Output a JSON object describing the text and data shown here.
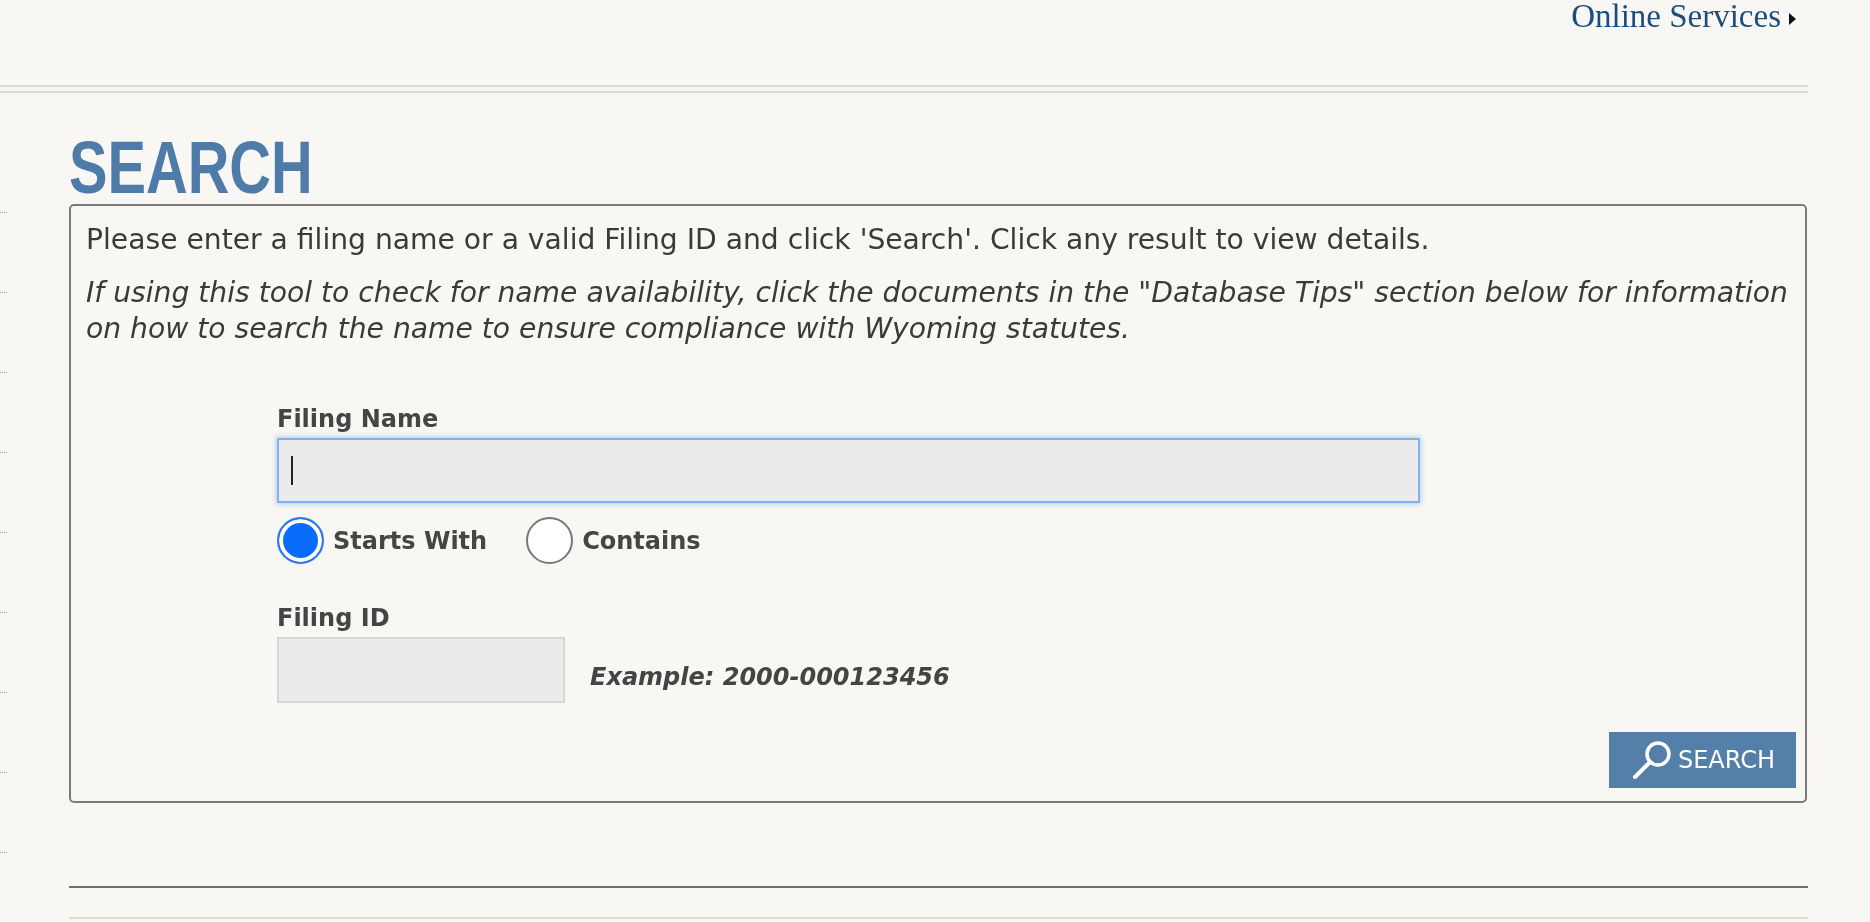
{
  "header": {
    "link": "Online Services"
  },
  "page_title": "SEARCH",
  "search_panel": {
    "intro": "Please enter a filing name or a valid Filing ID and click 'Search'. Click any result to view details.",
    "note": "If using this tool to check for name availability, click the documents in the \"Database Tips\" section below for information on how to search the name to ensure compliance with Wyoming statutes.",
    "filing_name": {
      "label": "Filing Name",
      "focused": true
    },
    "match_options": [
      {
        "label": "Starts With",
        "selected": true
      },
      {
        "label": "Contains",
        "selected": false
      }
    ],
    "filing_id": {
      "label": "Filing ID",
      "hint": "Example: 2000-000123456"
    },
    "search_button": {
      "label": "SEARCH"
    }
  }
}
